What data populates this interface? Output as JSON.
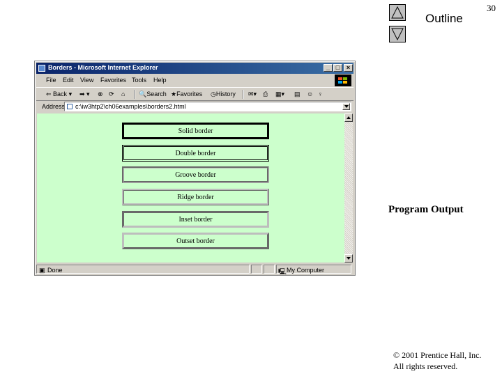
{
  "slide": {
    "number": "30",
    "outline_label": "Outline",
    "program_output_label": "Program Output",
    "copyright_line1": "© 2001 Prentice Hall, Inc.",
    "copyright_line2": "All rights reserved."
  },
  "nav": {
    "up_icon": "triangle-up-icon",
    "down_icon": "triangle-down-icon"
  },
  "browser": {
    "title": "Borders - Microsoft Internet Explorer",
    "menu": [
      "File",
      "Edit",
      "View",
      "Favorites",
      "Tools",
      "Help"
    ],
    "toolbar": {
      "back_label": "Back",
      "search_label": "Search",
      "favorites_label": "Favorites",
      "history_label": "History"
    },
    "address_label": "Address",
    "address_value": "c:\\iw3htp2\\ch06examples\\borders2.html",
    "status_left": "Done",
    "status_zone": "My Computer"
  },
  "content": {
    "boxes": [
      {
        "label": "Solid border",
        "style": "solid"
      },
      {
        "label": "Double border",
        "style": "double"
      },
      {
        "label": "Groove border",
        "style": "groove"
      },
      {
        "label": "Ridge border",
        "style": "ridge"
      },
      {
        "label": "Inset border",
        "style": "inset"
      },
      {
        "label": "Outset border",
        "style": "outset"
      }
    ],
    "background_color": "#ccffcc"
  }
}
